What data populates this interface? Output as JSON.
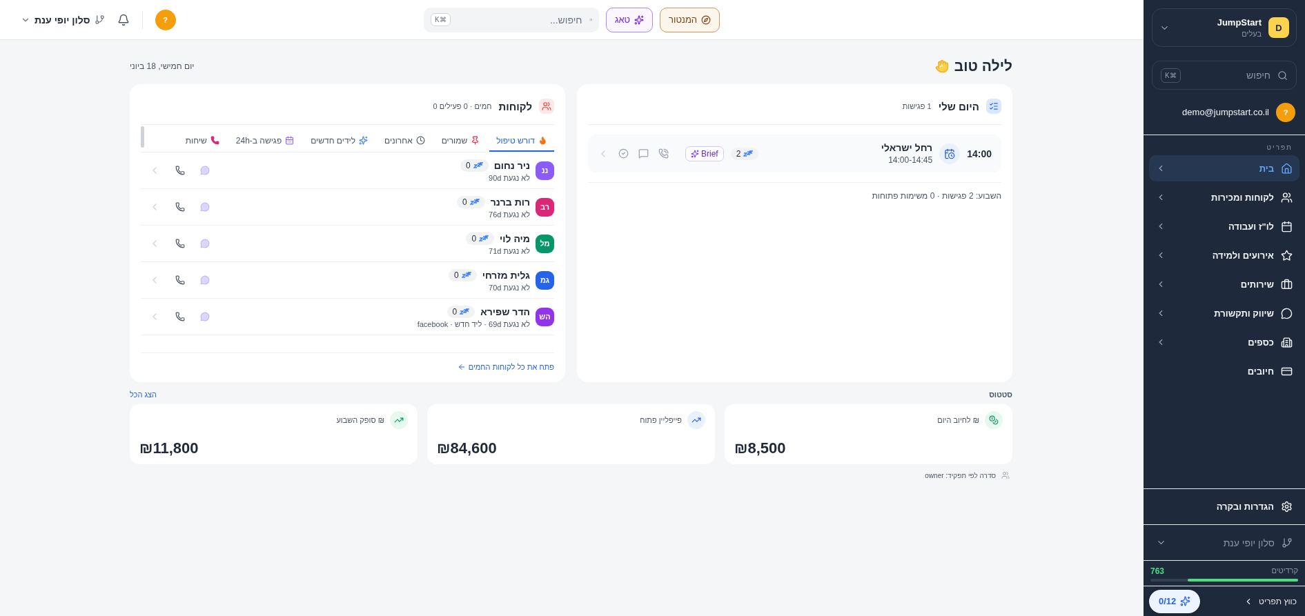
{
  "topbar": {
    "branch": "סלון יופי ענת",
    "avatar": "?",
    "buttons": [
      {
        "label": "המנטור",
        "kind": "mentor"
      },
      {
        "label": "טאג",
        "kind": "ai"
      }
    ],
    "search": {
      "placeholder": "חיפוש...",
      "shortcut": "⌘K"
    }
  },
  "greeting": "לילה טוב",
  "date": "יום חמישי, 18 ביוני",
  "my_day": {
    "title": "היום שלי",
    "count": "1 פגישות",
    "meetings": [
      {
        "time": "14:00",
        "name": "רחל ישראלי",
        "range": "14:00-14:45",
        "badge": "2",
        "brief": "Brief"
      }
    ],
    "summary": "השבוע: 2 פגישות · 0 משימות פתוחות"
  },
  "customers": {
    "title": "לקוחות",
    "subtitle": "חמים · 0 פעילים 0",
    "tabs": [
      {
        "label": "דורש טיפול",
        "selected": true
      },
      {
        "label": "שמורים",
        "selected": false
      },
      {
        "label": "אחרונים",
        "selected": false
      },
      {
        "label": "לידים חדשים",
        "selected": false
      },
      {
        "label": "פגישה ב-24h",
        "selected": false
      },
      {
        "label": "שיחות",
        "selected": false
      }
    ],
    "rows": [
      {
        "initials": "ננ",
        "color": "#8b5cf6",
        "name": "ניר נחום",
        "badge": "0",
        "meta": "לא נגעת 90d"
      },
      {
        "initials": "רב",
        "color": "#db2777",
        "name": "רות ברנר",
        "badge": "0",
        "meta": "לא נגעת 76d"
      },
      {
        "initials": "מל",
        "color": "#059669",
        "name": "מיה לוי",
        "badge": "0",
        "meta": "לא נגעת 71d"
      },
      {
        "initials": "גמ",
        "color": "#2563eb",
        "name": "גלית מזרחי",
        "badge": "0",
        "meta": "לא נגעת 70d"
      },
      {
        "initials": "הש",
        "color": "#9333ea",
        "name": "הדר שפירא",
        "badge": "0",
        "meta": "לא נגעת 69d · ליד חדש · facebook"
      }
    ],
    "footer_link": "פתח את כל לקוחות החמים"
  },
  "status": {
    "title": "סטטוס",
    "link": "הצג הכל",
    "stats": [
      {
        "label": "₪ לחיוב היום",
        "value": "₪8,500",
        "kind": "coins"
      },
      {
        "label": "פייפליין פתוח",
        "value": "₪84,600",
        "kind": "trend-blue"
      },
      {
        "label": "₪ סופק השבוע",
        "value": "₪11,800",
        "kind": "trend-green"
      }
    ],
    "footer": "סדרה לפי תפקיד: owner"
  },
  "sidebar": {
    "org": {
      "name": "JumpStart",
      "role": "בעלים",
      "avatar": "D"
    },
    "search": {
      "placeholder": "חיפוש",
      "shortcut": "⌘K"
    },
    "user": {
      "email": "demo@jumpstart.co.il",
      "avatar": "?"
    },
    "section": "תפריט",
    "items": [
      {
        "label": "בית",
        "selected": true,
        "expandable": true
      },
      {
        "label": "לקוחות ומכירות",
        "selected": false,
        "expandable": true
      },
      {
        "label": "לו\"ז ועבודה",
        "selected": false,
        "expandable": true
      },
      {
        "label": "אירועים ולמידה",
        "selected": false,
        "expandable": true
      },
      {
        "label": "שירותים",
        "selected": false,
        "expandable": true
      },
      {
        "label": "שיווק ותקשורת",
        "selected": false,
        "expandable": true
      },
      {
        "label": "כספים",
        "selected": false,
        "expandable": true
      },
      {
        "label": "חיובים",
        "selected": false,
        "expandable": false
      }
    ],
    "settings": "הגדרות ובקרה",
    "branch": "סלון יופי ענת",
    "credits": {
      "label": "קרדיטים",
      "value": "763",
      "level": 0.75
    },
    "collapse": "כווץ תפריט",
    "ai_counter": "0/12"
  }
}
